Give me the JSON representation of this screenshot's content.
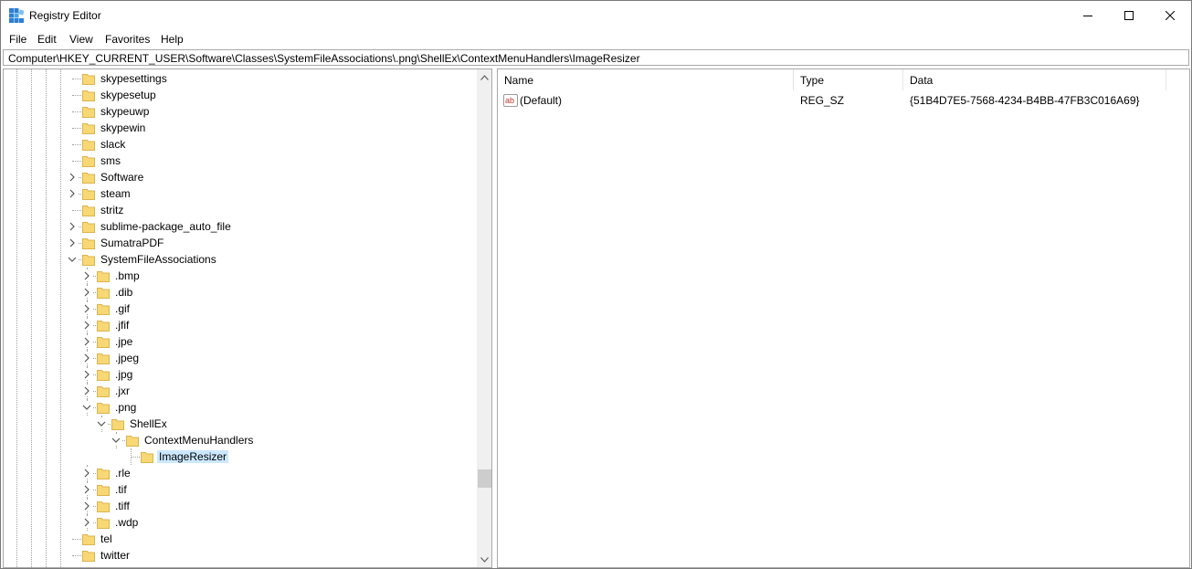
{
  "window": {
    "title": "Registry Editor",
    "app_icon": "registry-editor-icon",
    "controls": [
      "minimize-icon",
      "maximize-icon",
      "close-icon"
    ]
  },
  "menu": [
    "File",
    "Edit",
    "View",
    "Favorites",
    "Help"
  ],
  "address": "Computer\\HKEY_CURRENT_USER\\Software\\Classes\\SystemFileAssociations\\.png\\ShellEx\\ContextMenuHandlers\\ImageResizer",
  "tree": {
    "nodes": [
      {
        "label": "skypesettings",
        "depth": 0,
        "state": "leaf"
      },
      {
        "label": "skypesetup",
        "depth": 0,
        "state": "leaf"
      },
      {
        "label": "skypeuwp",
        "depth": 0,
        "state": "leaf"
      },
      {
        "label": "skypewin",
        "depth": 0,
        "state": "leaf"
      },
      {
        "label": "slack",
        "depth": 0,
        "state": "leaf"
      },
      {
        "label": "sms",
        "depth": 0,
        "state": "leaf"
      },
      {
        "label": "Software",
        "depth": 0,
        "state": "collapsed"
      },
      {
        "label": "steam",
        "depth": 0,
        "state": "collapsed"
      },
      {
        "label": "stritz",
        "depth": 0,
        "state": "leaf"
      },
      {
        "label": "sublime-package_auto_file",
        "depth": 0,
        "state": "collapsed"
      },
      {
        "label": "SumatraPDF",
        "depth": 0,
        "state": "collapsed"
      },
      {
        "label": "SystemFileAssociations",
        "depth": 0,
        "state": "expanded"
      },
      {
        "label": ".bmp",
        "depth": 1,
        "state": "collapsed"
      },
      {
        "label": ".dib",
        "depth": 1,
        "state": "collapsed"
      },
      {
        "label": ".gif",
        "depth": 1,
        "state": "collapsed"
      },
      {
        "label": ".jfif",
        "depth": 1,
        "state": "collapsed"
      },
      {
        "label": ".jpe",
        "depth": 1,
        "state": "collapsed"
      },
      {
        "label": ".jpeg",
        "depth": 1,
        "state": "collapsed"
      },
      {
        "label": ".jpg",
        "depth": 1,
        "state": "collapsed"
      },
      {
        "label": ".jxr",
        "depth": 1,
        "state": "collapsed"
      },
      {
        "label": ".png",
        "depth": 1,
        "state": "expanded"
      },
      {
        "label": "ShellEx",
        "depth": 2,
        "state": "expanded"
      },
      {
        "label": "ContextMenuHandlers",
        "depth": 3,
        "state": "expanded"
      },
      {
        "label": "ImageResizer",
        "depth": 4,
        "state": "leaf",
        "selected": true
      },
      {
        "label": ".rle",
        "depth": 1,
        "state": "collapsed"
      },
      {
        "label": ".tif",
        "depth": 1,
        "state": "collapsed"
      },
      {
        "label": ".tiff",
        "depth": 1,
        "state": "collapsed"
      },
      {
        "label": ".wdp",
        "depth": 1,
        "state": "collapsed"
      },
      {
        "label": "tel",
        "depth": 0,
        "state": "leaf"
      },
      {
        "label": "twitter",
        "depth": 0,
        "state": "leaf"
      }
    ]
  },
  "values": {
    "columns": [
      "Name",
      "Type",
      "Data"
    ],
    "rows": [
      {
        "name": "(Default)",
        "type": "REG_SZ",
        "data": "{51B4D7E5-7568-4234-B4BB-47FB3C016A69}",
        "icon": "string-value-icon"
      }
    ]
  },
  "colors": {
    "selection": "#cce8ff",
    "folder": "#f8d775",
    "folder_edge": "#dcb44e"
  }
}
